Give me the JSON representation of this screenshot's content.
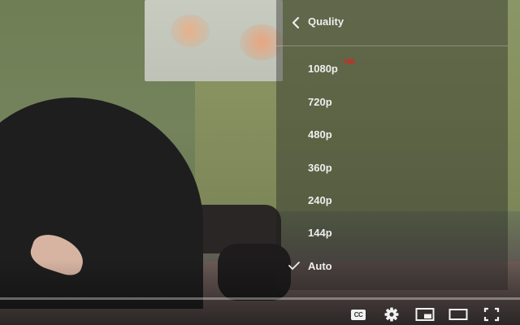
{
  "player": {
    "quality_menu": {
      "title": "Quality",
      "back_icon": "chevron-left-icon",
      "hd_badge": "HD",
      "options": [
        {
          "label": "1080p",
          "hd": true,
          "selected": false
        },
        {
          "label": "720p",
          "hd": false,
          "selected": false
        },
        {
          "label": "480p",
          "hd": false,
          "selected": false
        },
        {
          "label": "360p",
          "hd": false,
          "selected": false
        },
        {
          "label": "240p",
          "hd": false,
          "selected": false
        },
        {
          "label": "144p",
          "hd": false,
          "selected": false
        },
        {
          "label": "Auto",
          "hd": false,
          "selected": true
        }
      ]
    },
    "controls": {
      "cc_label": "CC",
      "icons": [
        "subtitles-icon",
        "settings-gear-icon",
        "miniplayer-icon",
        "theater-mode-icon",
        "fullscreen-icon"
      ]
    }
  },
  "colors": {
    "hd_badge": "#e02020",
    "menu_text": "#eeeeee"
  }
}
